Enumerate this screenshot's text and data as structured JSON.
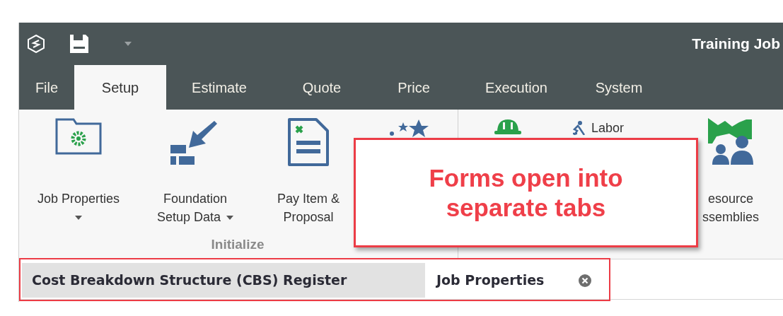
{
  "app": {
    "title": "Training Job"
  },
  "ribbon_tabs": [
    {
      "label": "File",
      "selected": false
    },
    {
      "label": "Setup",
      "selected": true
    },
    {
      "label": "Estimate",
      "selected": false
    },
    {
      "label": "Quote",
      "selected": false
    },
    {
      "label": "Price",
      "selected": false
    },
    {
      "label": "Execution",
      "selected": false
    },
    {
      "label": "System",
      "selected": false
    }
  ],
  "ribbon_groups": [
    {
      "label": "Initialize",
      "buttons": [
        {
          "kind": "large",
          "lines": [
            "Job Properties"
          ],
          "dropdown": true
        },
        {
          "kind": "large",
          "lines": [
            "Foundation",
            "Setup Data"
          ],
          "dropdown": true
        },
        {
          "kind": "large",
          "lines": [
            "Pay Item &",
            "Proposal"
          ]
        },
        {
          "kind": "large"
        }
      ]
    },
    {
      "buttons": [
        {
          "kind": "large"
        },
        {
          "kind": "small",
          "lines": [
            "Labor"
          ]
        },
        {
          "kind": "large",
          "lines": [
            "esource",
            "ssemblies"
          ]
        }
      ]
    }
  ],
  "document_tabs": [
    {
      "label": "Cost Breakdown Structure (CBS) Register",
      "selected": false
    },
    {
      "label": "Job Properties",
      "selected": true,
      "closable": true
    }
  ],
  "callout": {
    "text": "Forms open into separate tabs"
  }
}
